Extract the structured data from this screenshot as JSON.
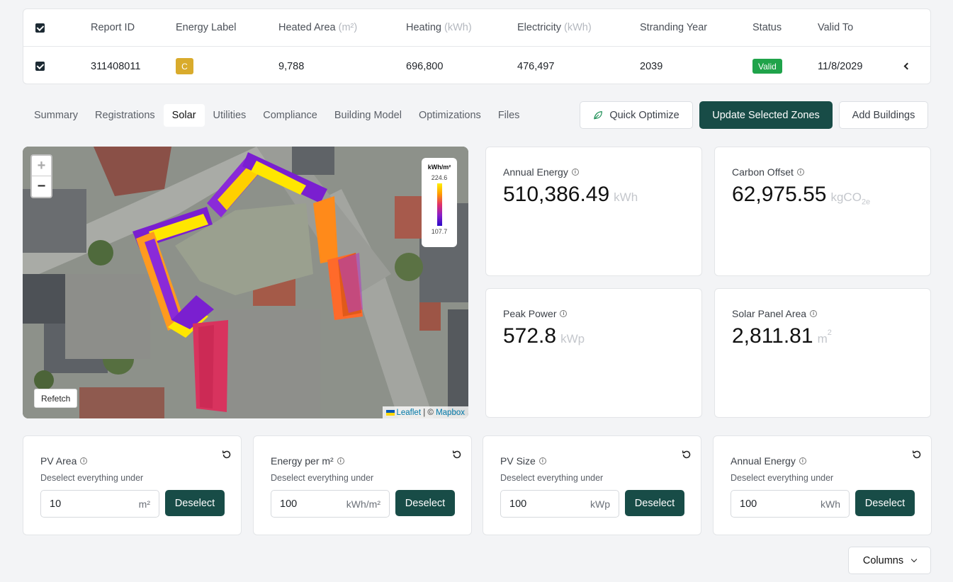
{
  "table": {
    "headers": {
      "report_id": "Report ID",
      "energy_label": "Energy Label",
      "heated_area": "Heated Area",
      "heated_area_unit": "(m²)",
      "heating": "Heating",
      "heating_unit": "(kWh)",
      "electricity": "Electricity",
      "electricity_unit": "(kWh)",
      "stranding_year": "Stranding Year",
      "status": "Status",
      "valid_to": "Valid To"
    },
    "row": {
      "report_id": "311408011",
      "energy_label": "C",
      "heated_area": "9,788",
      "heating": "696,800",
      "electricity": "476,497",
      "stranding_year": "2039",
      "status": "Valid",
      "valid_to": "11/8/2029"
    },
    "status_color": "#1fa34a",
    "label_color": "#d9ab2c"
  },
  "tabs": [
    "Summary",
    "Registrations",
    "Solar",
    "Utilities",
    "Compliance",
    "Building Model",
    "Optimizations",
    "Files"
  ],
  "active_tab": "Solar",
  "actions": {
    "quick_optimize": "Quick Optimize",
    "update_zones": "Update Selected Zones",
    "add_buildings": "Add Buildings"
  },
  "map": {
    "zoom_in": "+",
    "zoom_out": "−",
    "legend_title": "kWh/m²",
    "legend_max": "224.6",
    "legend_min": "107.7",
    "refetch": "Refetch",
    "attribution_leaflet": "Leaflet",
    "attribution_sep": " | © ",
    "attribution_mapbox": "Mapbox"
  },
  "stats": {
    "annual_energy": {
      "label": "Annual Energy",
      "value": "510,386.49",
      "unit": "kWh"
    },
    "carbon_offset": {
      "label": "Carbon Offset",
      "value": "62,975.55",
      "unit": "kgCO",
      "unit_sub": "2e"
    },
    "peak_power": {
      "label": "Peak Power",
      "value": "572.8",
      "unit": "kWp"
    },
    "panel_area": {
      "label": "Solar Panel Area",
      "value": "2,811.81",
      "unit": "m",
      "unit_sup": "2"
    }
  },
  "filters": {
    "subtitle": "Deselect everything under",
    "button": "Deselect",
    "items": [
      {
        "title": "PV Area",
        "value": "10",
        "unit": "m²"
      },
      {
        "title": "Energy per m²",
        "value": "100",
        "unit": "kWh/m²"
      },
      {
        "title": "PV Size",
        "value": "100",
        "unit": "kWp"
      },
      {
        "title": "Annual Energy",
        "value": "100",
        "unit": "kWh"
      }
    ]
  },
  "columns_button": "Columns",
  "accent_color": "#184c47"
}
